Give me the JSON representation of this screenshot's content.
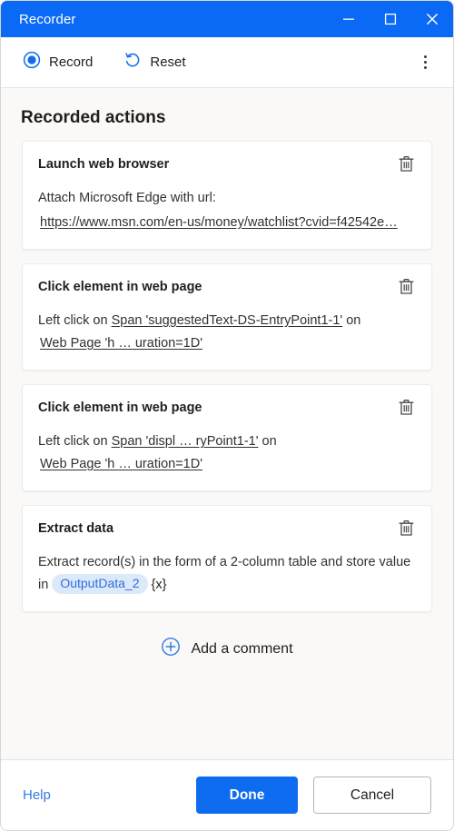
{
  "window": {
    "title": "Recorder",
    "controls": {
      "minimize": "minimize-icon",
      "maximize": "maximize-icon",
      "close": "close-icon"
    }
  },
  "toolbar": {
    "record_label": "Record",
    "record_icon": "record-circle-icon",
    "reset_label": "Reset",
    "reset_icon": "reset-arrow-icon",
    "more_icon": "more-options-icon"
  },
  "main": {
    "section_title": "Recorded actions",
    "delete_icon": "trash-icon",
    "cards": [
      {
        "title": "Launch web browser",
        "text_prefix": "Attach Microsoft Edge with url:",
        "url": "https://www.msn.com/en-us/money/watchlist?cvid=f42542e…"
      },
      {
        "title": "Click element in web page",
        "line1_prefix": "Left click on ",
        "line1_link": "Span 'suggestedText-DS-EntryPoint1-1'",
        "line1_suffix": " on",
        "line2_link": "Web Page 'h … uration=1D'"
      },
      {
        "title": "Click element in web page",
        "line1_prefix": "Left click on ",
        "line1_link": "Span 'displ … ryPoint1-1'",
        "line1_suffix": " on",
        "line2_link": "Web Page 'h … uration=1D'"
      },
      {
        "title": "Extract data",
        "text": "Extract record(s) in the form of a 2-column table and store value in",
        "variable": "OutputData_2",
        "variable_suffix": "{x}"
      }
    ],
    "add_comment_label": "Add a comment",
    "add_comment_icon": "plus-circle-icon"
  },
  "footer": {
    "help_label": "Help",
    "done_label": "Done",
    "cancel_label": "Cancel"
  },
  "colors": {
    "title_bar": "#0a69f5",
    "primary_button": "#0e6cf0",
    "link": "#2f7ae5",
    "variable_pill_bg": "#dbe9fb",
    "variable_pill_text": "#2f6fd8",
    "page_bg": "#faf9f8"
  }
}
